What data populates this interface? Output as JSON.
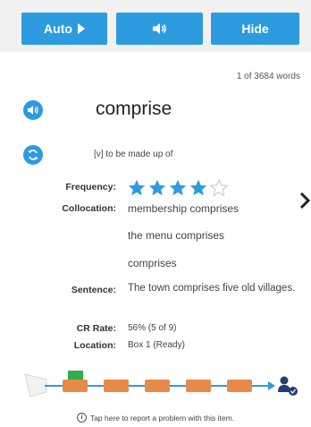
{
  "toolbar": {
    "auto_label": "Auto",
    "hide_label": "Hide"
  },
  "counter": "1 of 3684 words",
  "word": "comprise",
  "definition": "[v] to be made up of",
  "frequency": {
    "label": "Frequency:",
    "stars_filled": 4,
    "stars_total": 5
  },
  "collocation": {
    "label": "Collocation:",
    "items": [
      "membership comprises",
      "the menu comprises",
      "comprises"
    ]
  },
  "sentence": {
    "label": "Sentence:",
    "text": "The town comprises five old villages."
  },
  "cr_rate": {
    "label": "CR Rate:",
    "value": "56% (5 of 9)"
  },
  "location": {
    "label": "Location:",
    "value": "Box 1 (Ready)"
  },
  "progress": {
    "boxes": 5,
    "current_box": 1
  },
  "report": "Tap here to report a problem with this item.",
  "colors": {
    "accent": "#2d9bdf",
    "box": "#e68a4a",
    "current": "#2fae4a",
    "line": "#2d9bdf"
  }
}
